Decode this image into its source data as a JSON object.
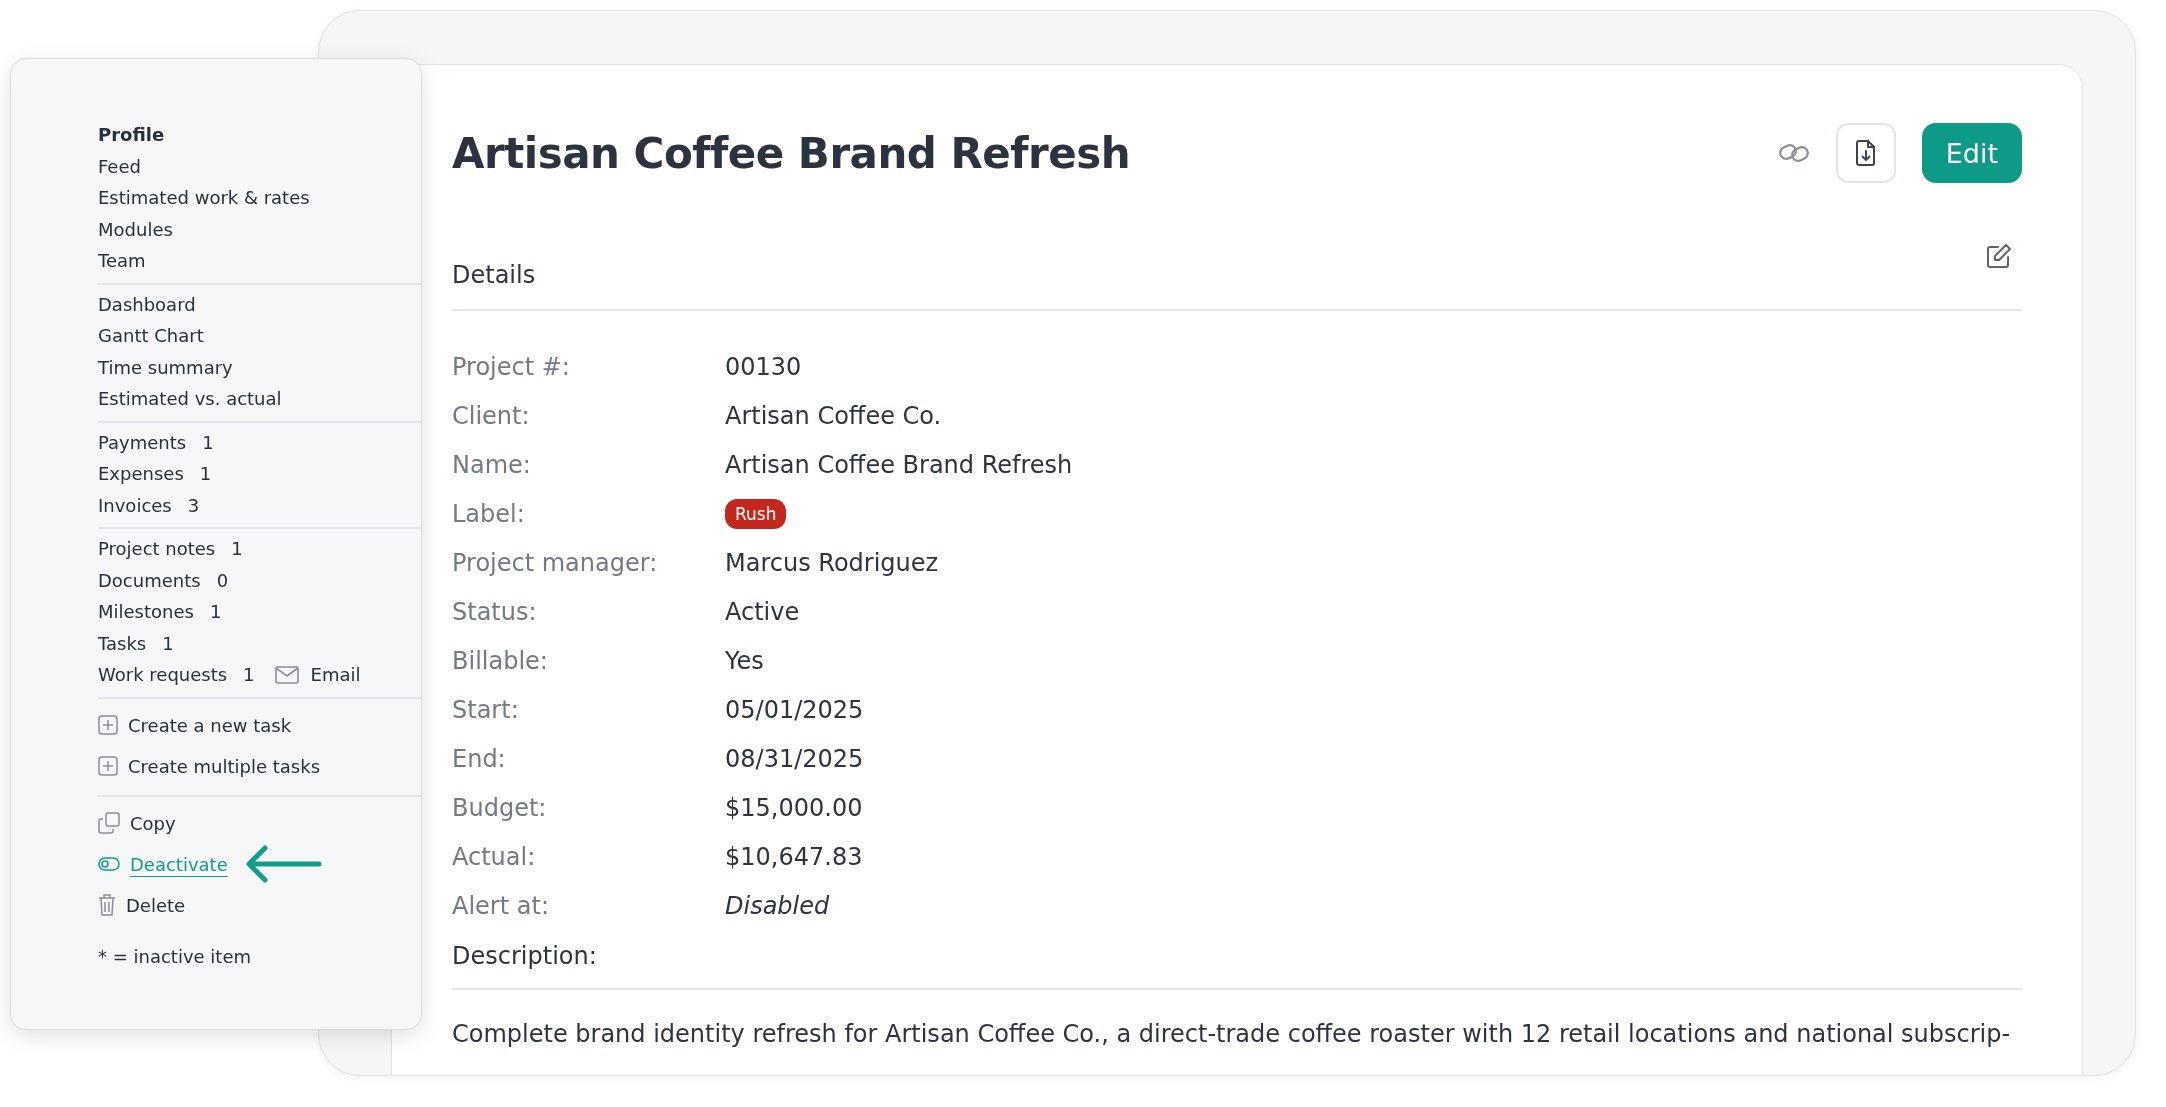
{
  "sidebar": {
    "groups": [
      {
        "kind": "links",
        "items": [
          {
            "label": "Profile",
            "selected": true
          },
          {
            "label": "Feed",
            "selected": false
          },
          {
            "label": "Estimated work & rates",
            "selected": false
          },
          {
            "label": "Modules",
            "selected": false
          },
          {
            "label": "Team",
            "selected": false
          }
        ]
      },
      {
        "kind": "links",
        "items": [
          {
            "label": "Dashboard",
            "selected": false
          },
          {
            "label": "Gantt Chart",
            "selected": false
          },
          {
            "label": "Time summary",
            "selected": false
          },
          {
            "label": "Estimated vs. actual",
            "selected": false
          }
        ]
      },
      {
        "kind": "links",
        "items": [
          {
            "label": "Payments",
            "count": "1",
            "selected": false
          },
          {
            "label": "Expenses",
            "count": "1",
            "selected": false
          },
          {
            "label": "Invoices",
            "count": "3",
            "selected": false
          }
        ]
      },
      {
        "kind": "links",
        "items": [
          {
            "label": "Project notes",
            "count": "1",
            "selected": false
          },
          {
            "label": "Documents",
            "count": "0",
            "selected": false
          },
          {
            "label": "Milestones",
            "count": "1",
            "selected": false
          },
          {
            "label": "Tasks",
            "count": "1",
            "selected": false
          },
          {
            "label": "Work requests",
            "count": "1",
            "extra": "Email",
            "selected": false
          }
        ]
      },
      {
        "kind": "actions",
        "items": [
          {
            "label": "Create a new task",
            "kind": "plus",
            "highlighted": false
          },
          {
            "label": "Create multiple tasks",
            "kind": "plus",
            "highlighted": false
          }
        ]
      },
      {
        "kind": "actions",
        "items": [
          {
            "label": "Copy",
            "kind": "copy",
            "highlighted": false
          },
          {
            "label": "Deactivate",
            "kind": "toggle",
            "highlighted": true
          },
          {
            "label": "Delete",
            "kind": "trash",
            "highlighted": false
          }
        ]
      }
    ],
    "footnote": "* = inactive item"
  },
  "project": {
    "title": "Artisan Coffee Brand Refresh",
    "edit_button": "Edit",
    "details_heading": "Details",
    "fields": [
      {
        "label": "Project #:",
        "value": "00130",
        "kind": "text"
      },
      {
        "label": "Client:",
        "value": "Artisan Coffee Co.",
        "kind": "text"
      },
      {
        "label": "Name:",
        "value": "Artisan Coffee Brand Refresh",
        "kind": "text"
      },
      {
        "label": "Label:",
        "value": "Rush",
        "kind": "badge",
        "color": "#c4281c"
      },
      {
        "label": "Project manager:",
        "value": "Marcus Rodriguez",
        "kind": "text"
      },
      {
        "label": "Status:",
        "value": "Active",
        "kind": "text"
      },
      {
        "label": "Billable:",
        "value": "Yes",
        "kind": "text"
      },
      {
        "label": "Start:",
        "value": "05/01/2025",
        "kind": "text"
      },
      {
        "label": "End:",
        "value": "08/31/2025",
        "kind": "text"
      },
      {
        "label": "Budget:",
        "value": "$15,000.00",
        "kind": "text"
      },
      {
        "label": "Actual:",
        "value": "$10,647.83",
        "kind": "text"
      },
      {
        "label": "Alert at:",
        "value": "Disabled",
        "kind": "italic"
      }
    ],
    "description_heading": "Description:",
    "description": "Complete brand identity refresh for Artisan Coffee Co., a direct-trade coffee roaster with 12 retail locations and national subscrip-"
  }
}
